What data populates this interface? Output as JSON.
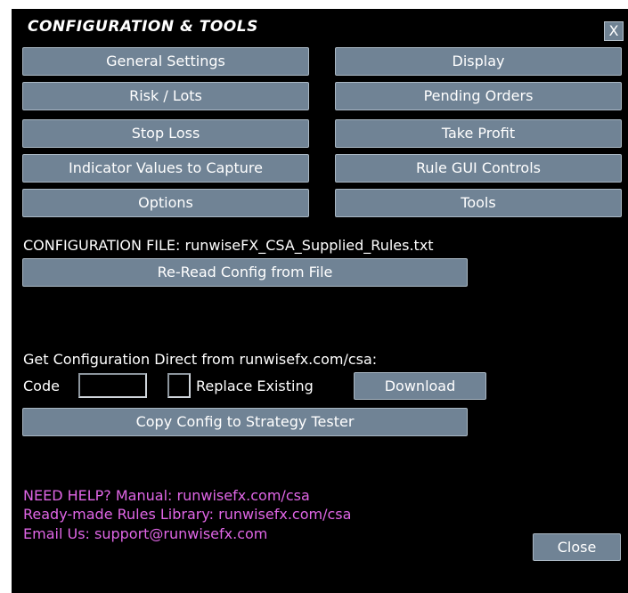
{
  "title": "CONFIGURATION & TOOLS",
  "close_x_label": "X",
  "menu_buttons": [
    {
      "label": "General Settings"
    },
    {
      "label": "Display"
    },
    {
      "label": "Risk / Lots"
    },
    {
      "label": "Pending Orders"
    },
    {
      "label": "Stop Loss"
    },
    {
      "label": "Take Profit"
    },
    {
      "label": "Indicator Values to Capture"
    },
    {
      "label": "Rule GUI Controls"
    },
    {
      "label": "Options"
    },
    {
      "label": "Tools"
    }
  ],
  "config_file_label": "CONFIGURATION FILE: runwiseFX_CSA_Supplied_Rules.txt",
  "reread_button": "Re-Read Config from File",
  "get_config_label": "Get Configuration Direct from runwisefx.com/csa:",
  "code_label": "Code",
  "code_value": "",
  "replace_existing_label": "Replace Existing",
  "download_button": "Download",
  "copy_config_button": "Copy Config to Strategy Tester",
  "help_lines": [
    "NEED HELP? Manual: runwisefx.com/csa",
    "Ready-made Rules Library: runwisefx.com/csa",
    "Email Us: support@runwisefx.com"
  ],
  "close_button": "Close",
  "colors": {
    "panel_bg": "#000000",
    "button_bg": "#708395",
    "help_text": "#e066e6"
  }
}
